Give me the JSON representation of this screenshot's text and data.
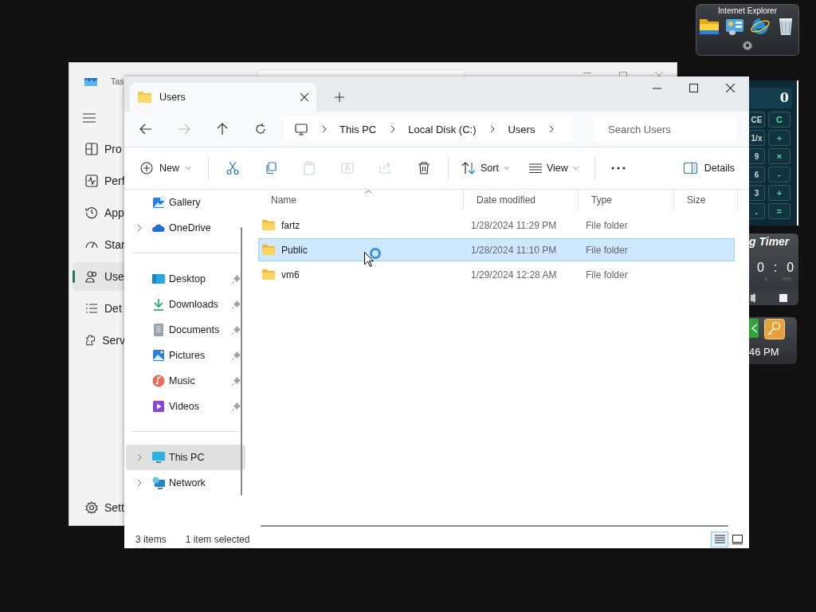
{
  "task_manager": {
    "title": "Tas",
    "nav": [
      {
        "kind": "processes",
        "label": "Pro",
        "selected": false
      },
      {
        "kind": "performance",
        "label": "Perf",
        "selected": false
      },
      {
        "kind": "history",
        "label": "App",
        "selected": false
      },
      {
        "kind": "startup",
        "label": "Star",
        "selected": false
      },
      {
        "kind": "users",
        "label": "Use",
        "selected": true
      },
      {
        "kind": "details",
        "label": "Det",
        "selected": false
      },
      {
        "kind": "services",
        "label": "Serv",
        "selected": false
      }
    ],
    "settings": {
      "label": "Sett"
    }
  },
  "explorer": {
    "tab": {
      "title": "Users"
    },
    "nav_buttons": [
      {
        "kind": "back",
        "disabled": false
      },
      {
        "kind": "forward",
        "disabled": true
      },
      {
        "kind": "up",
        "disabled": false
      },
      {
        "kind": "refresh",
        "disabled": false
      }
    ],
    "breadcrumb": [
      "This PC",
      "Local Disk (C:)",
      "Users"
    ],
    "search": {
      "placeholder": "Search Users"
    },
    "toolbar": {
      "new": {
        "label": "New"
      },
      "actions": [
        {
          "kind": "cut",
          "disabled": false
        },
        {
          "kind": "copy",
          "disabled": false
        },
        {
          "kind": "paste",
          "disabled": true
        },
        {
          "kind": "rename",
          "disabled": true
        },
        {
          "kind": "share",
          "disabled": true
        },
        {
          "kind": "delete",
          "disabled": false
        }
      ],
      "sort": {
        "label": "Sort"
      },
      "view": {
        "label": "View"
      },
      "details": {
        "label": "Details"
      }
    },
    "sidebar": [
      [
        {
          "kind": "gallery",
          "label": "Gallery",
          "expandable": false,
          "pinned": false,
          "selected": false
        },
        {
          "kind": "onedrive",
          "label": "OneDrive",
          "expandable": true,
          "pinned": false,
          "selected": false
        }
      ],
      [
        {
          "kind": "desktop",
          "label": "Desktop",
          "expandable": false,
          "pinned": true,
          "selected": false
        },
        {
          "kind": "downloads",
          "label": "Downloads",
          "expandable": false,
          "pinned": true,
          "selected": false
        },
        {
          "kind": "documents",
          "label": "Documents",
          "expandable": false,
          "pinned": true,
          "selected": false
        },
        {
          "kind": "pictures",
          "label": "Pictures",
          "expandable": false,
          "pinned": true,
          "selected": false
        },
        {
          "kind": "music",
          "label": "Music",
          "expandable": false,
          "pinned": true,
          "selected": false
        },
        {
          "kind": "videos",
          "label": "Videos",
          "expandable": false,
          "pinned": true,
          "selected": false
        }
      ],
      [
        {
          "kind": "thispc",
          "label": "This PC",
          "expandable": true,
          "pinned": false,
          "selected": true
        },
        {
          "kind": "network",
          "label": "Network",
          "expandable": true,
          "pinned": false,
          "selected": false
        }
      ]
    ],
    "columns": [
      "Name",
      "Date modified",
      "Type",
      "Size"
    ],
    "rows": [
      {
        "name": "fartz",
        "date": "1/28/2024 11:29 PM",
        "type": "File folder",
        "selected": false
      },
      {
        "name": "Public",
        "date": "1/28/2024 11:10 PM",
        "type": "File folder",
        "selected": true
      },
      {
        "name": "vm6",
        "date": "1/29/2024 12:28 AM",
        "type": "File folder",
        "selected": false
      }
    ],
    "status": {
      "count": "3 items",
      "selection": "1 item selected"
    },
    "view_modes": [
      {
        "kind": "details",
        "selected": true
      },
      {
        "kind": "tiles",
        "selected": false
      }
    ]
  },
  "gadgets": {
    "launcher": {
      "title": "Internet Explorer",
      "icons": [
        {
          "kind": "folder"
        },
        {
          "kind": "control-panel"
        },
        {
          "kind": "browser"
        },
        {
          "kind": "recycle-bin"
        }
      ]
    },
    "calculator": {
      "display": "0",
      "keys": [
        [
          "CE",
          "C"
        ],
        [
          "1/x",
          "÷"
        ],
        [
          "9",
          "×"
        ],
        [
          "6",
          "-"
        ],
        [
          "3",
          "+"
        ],
        [
          ".",
          "="
        ]
      ]
    },
    "timer": {
      "title": "g Timer",
      "seconds": "0",
      "separator": ":",
      "millis": "0",
      "units": [
        "s",
        "ms"
      ]
    },
    "clock": {
      "time": "46 PM"
    }
  }
}
